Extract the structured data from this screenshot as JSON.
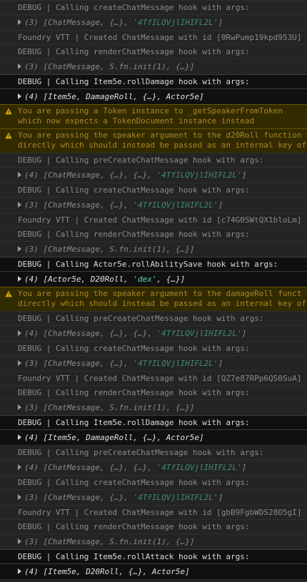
{
  "colors": {
    "background": "#242424",
    "highlight_bg": "#101010",
    "warning_bg": "#332b00",
    "warning_text": "#a8862a",
    "string_value": "#3f8a7a"
  },
  "rows": [
    {
      "kind": "log",
      "text": "DEBUG | Calling createChatMessage hook with args:"
    },
    {
      "kind": "args",
      "count": "(3)",
      "open": "[ChatMessage, {…}, ",
      "str": "'4TfILQVjlIHIFL2L'",
      "close": "]"
    },
    {
      "kind": "log",
      "text": "Foundry VTT | Created ChatMessage with id [0RwPump19kpd953U]"
    },
    {
      "kind": "log",
      "text": "DEBUG | Calling renderChatMessage hook with args:"
    },
    {
      "kind": "args",
      "count": "(3)",
      "open": "[ChatMessage, S.fn.init(1), {…}]",
      "str": "",
      "close": ""
    },
    {
      "kind": "log",
      "hl": true,
      "text": "DEBUG | Calling Item5e.rollDamage hook with args:"
    },
    {
      "kind": "args",
      "hl": true,
      "count": "(4)",
      "open": "[Item5e, DamageRoll, {…}, Actor5e]",
      "str": "",
      "close": ""
    },
    {
      "kind": "warn",
      "line1": "You are passing a Token instance to _getSpeakerFromToken",
      "line2": "which now expects a TokenDocument instance instead"
    },
    {
      "kind": "warn",
      "line1": "You are passing the speaker argument to the d20Roll function",
      "line2": "directly which should instead be passed as an internal key of"
    },
    {
      "kind": "log",
      "text": "DEBUG | Calling preCreateChatMessage hook with args:"
    },
    {
      "kind": "args",
      "count": "(4)",
      "open": "[ChatMessage, {…}, {…}, ",
      "str": "'4TfILQVjlIHIFL2L'",
      "close": "]"
    },
    {
      "kind": "log",
      "text": "DEBUG | Calling createChatMessage hook with args:"
    },
    {
      "kind": "args",
      "count": "(3)",
      "open": "[ChatMessage, {…}, ",
      "str": "'4TfILQVjlIHIFL2L'",
      "close": "]"
    },
    {
      "kind": "log",
      "text": "Foundry VTT | Created ChatMessage with id [c74G0SWtQX1bloLm]"
    },
    {
      "kind": "log",
      "text": "DEBUG | Calling renderChatMessage hook with args:"
    },
    {
      "kind": "args",
      "count": "(3)",
      "open": "[ChatMessage, S.fn.init(1), {…}]",
      "str": "",
      "close": ""
    },
    {
      "kind": "log",
      "hl": true,
      "text": "DEBUG | Calling Actor5e.rollAbilitySave hook with args:"
    },
    {
      "kind": "args",
      "hl": true,
      "count": "(4)",
      "open": "[Actor5e, D20Roll, ",
      "str": "'dex'",
      "close": ", {…}]"
    },
    {
      "kind": "warn",
      "line1": "You are passing the speaker argument to the damageRoll funct",
      "line2": "directly which should instead be passed as an internal key of"
    },
    {
      "kind": "log",
      "text": "DEBUG | Calling preCreateChatMessage hook with args:"
    },
    {
      "kind": "args",
      "count": "(4)",
      "open": "[ChatMessage, {…}, {…}, ",
      "str": "'4TfILQVjlIHIFL2L'",
      "close": "]"
    },
    {
      "kind": "log",
      "text": "DEBUG | Calling createChatMessage hook with args:"
    },
    {
      "kind": "args",
      "count": "(3)",
      "open": "[ChatMessage, {…}, ",
      "str": "'4TfILQVjlIHIFL2L'",
      "close": "]"
    },
    {
      "kind": "log",
      "text": "Foundry VTT | Created ChatMessage with id [QZ7e87RPp6QS0SuA]"
    },
    {
      "kind": "log",
      "text": "DEBUG | Calling renderChatMessage hook with args:"
    },
    {
      "kind": "args",
      "count": "(3)",
      "open": "[ChatMessage, S.fn.init(1), {…}]",
      "str": "",
      "close": ""
    },
    {
      "kind": "log",
      "hl": true,
      "text": "DEBUG | Calling Item5e.rollDamage hook with args:"
    },
    {
      "kind": "args",
      "hl": true,
      "count": "(4)",
      "open": "[Item5e, DamageRoll, {…}, Actor5e]",
      "str": "",
      "close": ""
    },
    {
      "kind": "log",
      "text": "DEBUG | Calling preCreateChatMessage hook with args:"
    },
    {
      "kind": "args",
      "count": "(4)",
      "open": "[ChatMessage, {…}, {…}, ",
      "str": "'4TfILQVjlIHIFL2L'",
      "close": "]"
    },
    {
      "kind": "log",
      "text": "DEBUG | Calling createChatMessage hook with args:"
    },
    {
      "kind": "args",
      "count": "(3)",
      "open": "[ChatMessage, {…}, ",
      "str": "'4TfILQVjlIHIFL2L'",
      "close": "]"
    },
    {
      "kind": "log",
      "text": "Foundry VTT | Created ChatMessage with id [gbB9FgbWDS28O5gI]"
    },
    {
      "kind": "log",
      "text": "DEBUG | Calling renderChatMessage hook with args:"
    },
    {
      "kind": "args",
      "count": "(3)",
      "open": "[ChatMessage, S.fn.init(1), {…}]",
      "str": "",
      "close": ""
    },
    {
      "kind": "log",
      "hl": true,
      "text": "DEBUG | Calling Item5e.rollAttack hook with args:"
    },
    {
      "kind": "args",
      "hl": true,
      "count": "(4)",
      "open": "[Item5e, D20Roll, {…}, Actor5e]",
      "str": "",
      "close": ""
    }
  ]
}
